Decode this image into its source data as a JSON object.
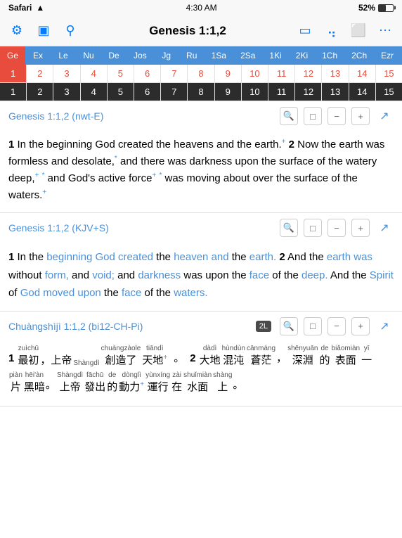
{
  "statusBar": {
    "carrier": "Safari",
    "time": "4:30 AM",
    "battery": "52%"
  },
  "navBar": {
    "title": "Genesis 1:1,2",
    "icons": [
      "gear",
      "book",
      "search",
      "monitor",
      "bookmark",
      "layers",
      "more"
    ]
  },
  "bookTabs": [
    {
      "label": "Ge",
      "active": true
    },
    {
      "label": "Ex"
    },
    {
      "label": "Le"
    },
    {
      "label": "Nu"
    },
    {
      "label": "De"
    },
    {
      "label": "Jos"
    },
    {
      "label": "Jg"
    },
    {
      "label": "Ru"
    },
    {
      "label": "1Sa"
    },
    {
      "label": "2Sa"
    },
    {
      "label": "1Ki"
    },
    {
      "label": "2Ki"
    },
    {
      "label": "1Ch"
    },
    {
      "label": "2Ch"
    },
    {
      "label": "Ezr"
    }
  ],
  "chapterRowRed": [
    "1",
    "2",
    "3",
    "4",
    "5",
    "6",
    "7",
    "8",
    "9",
    "10",
    "11",
    "12",
    "13",
    "14",
    "15"
  ],
  "chapterRowDark": [
    "1",
    "2",
    "3",
    "4",
    "5",
    "6",
    "7",
    "8",
    "9",
    "10",
    "11",
    "12",
    "13",
    "14",
    "15"
  ],
  "sections": [
    {
      "id": "nwt",
      "title": "Genesis 1:1,2 (nwt-E)",
      "icons": [
        "search",
        "comment",
        "minus",
        "plus",
        "expand"
      ],
      "verse1": "In the beginning God created the heavens and the earth.",
      "verse2": "Now the earth was formless and desolate,",
      "verse2b": "and there was darkness upon the surface of the watery deep,",
      "verse2c": "and God's active force",
      "verse2d": "was moving about over the surface of the waters."
    },
    {
      "id": "kjv",
      "title": "Genesis 1:1,2 (KJV+S)",
      "icons": [
        "search",
        "comment",
        "minus",
        "plus",
        "expand"
      ]
    },
    {
      "id": "cn",
      "title": "Chuàngshìjì 1:1,2 (bi12-CH-Pi)",
      "badge": "2L",
      "icons": [
        "search",
        "comment",
        "minus",
        "plus",
        "expand"
      ]
    }
  ],
  "kjvText": {
    "v1_pre": "In the ",
    "v1_hl1": "beginning God created",
    "v1_mid": " the ",
    "v1_hl2": "heaven and the earth.",
    "v2_pre": "And the ",
    "v2_hl1": "earth was",
    "v2_mid1": " without ",
    "v2_hl2": "form,",
    "v2_mid2": " and ",
    "v2_hl3": "void;",
    "v2_mid3": " and ",
    "v2_hl4": "darkness",
    "v2_mid4": " was upon the ",
    "v2_hl5": "face",
    "v2_mid5": " of the ",
    "v2_hl6": "deep.",
    "v2_mid6": " And the ",
    "v2_hl7": "Spirit",
    "v2_mid7": " of ",
    "v2_hl8": "God moved upon",
    "v2_mid8": " the ",
    "v2_hl9": "face",
    "v2_mid9": " of the ",
    "v2_hl10": "waters."
  },
  "cnText": {
    "v1_label": "1",
    "v1_pinyin1": "zuìchū",
    "v1_char1": "最初",
    "v1_p2": "",
    "v1_char2": "，",
    "v1_p3": "Shàngdì",
    "v1_char3": "上帝",
    "v1_p4": "chuàngzàole",
    "v1_char4": "創造了",
    "v1_p5": "tiāndì",
    "v1_char5": "天地",
    "v1_sup": "+",
    "v2_label": "2",
    "v2_p1": "dàdì",
    "v2_c1": "大地",
    "v2_p2": "hùndùn",
    "v2_c2": "混沌",
    "v2_p3": "cānmáng",
    "v2_c3": "蒼茫",
    "v2_sep": "，",
    "v2_p4": "shēnyuān",
    "v2_c4": "深淵",
    "v2_p5": "de",
    "v2_c5": "的",
    "v2_p6": "biǎomiàn",
    "v2_c6": "表面",
    "v2_p7": "yī",
    "v2_c7": "一",
    "v2b_p1": "piàn",
    "v2b_c1": "片",
    "v2b_p2": "hēi'àn",
    "v2b_c2": "黑暗",
    "v2b_sep": "。",
    "v2b_p3": "Shàngdì",
    "v2b_c3": "上帝",
    "v2b_p4": "fāchū",
    "v2b_c4": "發出",
    "v2b_p5": "de",
    "v2b_c5": "的",
    "v2b_p6": "dònglì",
    "v2b_c6": "動力",
    "v2b_sup": "+",
    "v2b_p7": "yùnxíng",
    "v2b_c7": "運行",
    "v2b_p8": "zài",
    "v2b_c8": "在",
    "v2b_p9": "shuǐmiàn",
    "v2b_c9": "水面",
    "v2b_p10": "shàng",
    "v2b_c10": "上",
    "v2b_end": "。"
  }
}
